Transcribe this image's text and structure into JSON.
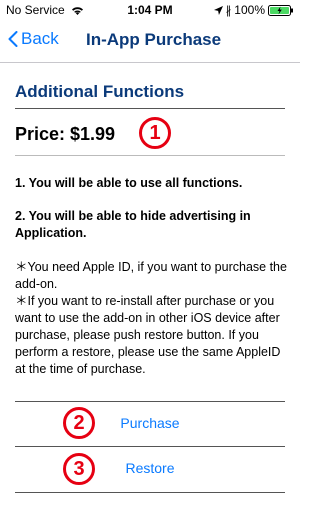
{
  "status_bar": {
    "carrier": "No Service",
    "time": "1:04 PM",
    "battery": "100%"
  },
  "nav": {
    "back_label": "Back",
    "title": "In-App Purchase"
  },
  "section": {
    "title": "Additional Functions"
  },
  "price": {
    "label": "Price: $1.99"
  },
  "markers": {
    "one": "1",
    "two": "2",
    "three": "3"
  },
  "functions": {
    "item1": "1. You will be able to use all functions.",
    "item2": "2. You will be able to hide advertising in Application."
  },
  "notes": {
    "note1": "＊You need Apple ID, if you want to purchase the add-on.",
    "note2": "＊If you want to re-install after purchase or you want to use the add-on in other iOS device  after purchase, please push restore button. If you perform a restore, please use the same AppleID at the time of purchase."
  },
  "actions": {
    "purchase_label": "Purchase",
    "restore_label": "Restore"
  },
  "colors": {
    "accent": "#0a7aff",
    "heading": "#0b3a7a",
    "marker": "#e60012"
  }
}
